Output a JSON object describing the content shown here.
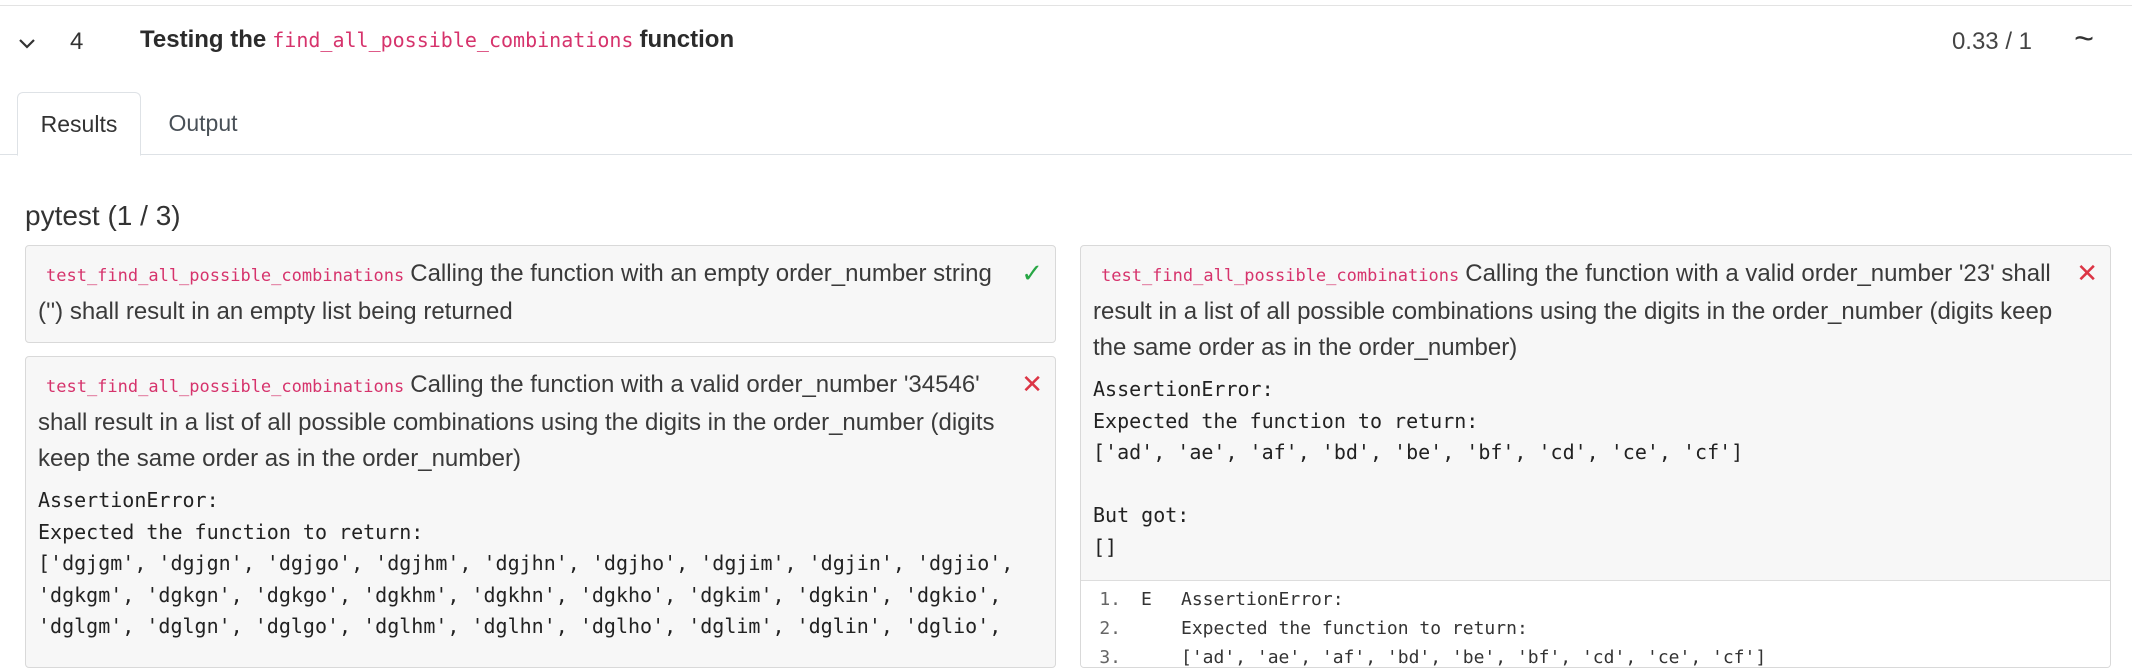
{
  "header": {
    "number": "4",
    "title_prefix": "Testing the",
    "title_code": "find_all_possible_combinations",
    "title_suffix": "function",
    "score": "0.33 / 1",
    "trend_symbol": "~"
  },
  "tabs": [
    {
      "label": "Results",
      "active": true
    },
    {
      "label": "Output",
      "active": false
    }
  ],
  "suite": {
    "title": "pytest (1 / 3)"
  },
  "tests": [
    {
      "name": "test_find_all_possible_combinations",
      "description": "Calling the function with an empty order_number string ('') shall result in an empty list being returned",
      "status": "pass",
      "status_icon": "✓"
    },
    {
      "name": "test_find_all_possible_combinations",
      "description": "Calling the function with a valid order_number '34546' shall result in a list of all possible combinations using the digits in the order_number (digits keep the same order as in the order_number)",
      "status": "fail",
      "status_icon": "✕",
      "error": "AssertionError:\nExpected the function to return:\n['dgjgm', 'dgjgn', 'dgjgo', 'dgjhm', 'dgjhn', 'dgjho', 'dgjim', 'dgjin', 'dgjio',\n'dgkgm', 'dgkgn', 'dgkgo', 'dgkhm', 'dgkhn', 'dgkho', 'dgkim', 'dgkin', 'dgkio',\n'dglgm', 'dglgn', 'dglgo', 'dglhm', 'dglhn', 'dglho', 'dglim', 'dglin', 'dglio',"
    },
    {
      "name": "test_find_all_possible_combinations",
      "description": "Calling the function with a valid order_number '23' shall result in a list of all possible combinations using the digits in the order_number (digits keep the same order as in the order_number)",
      "status": "fail",
      "status_icon": "✕",
      "error": "AssertionError:\nExpected the function to return:\n['ad', 'ae', 'af', 'bd', 'be', 'bf', 'cd', 'ce', 'cf']\n\nBut got:\n[]",
      "trace": [
        {
          "n": "1.",
          "m": "E",
          "t": "AssertionError:"
        },
        {
          "n": "2.",
          "m": "",
          "t": "Expected the function to return:"
        },
        {
          "n": "3.",
          "m": "",
          "t": "['ad', 'ae', 'af', 'bd', 'be', 'bf', 'cd', 'ce', 'cf']"
        }
      ]
    }
  ]
}
